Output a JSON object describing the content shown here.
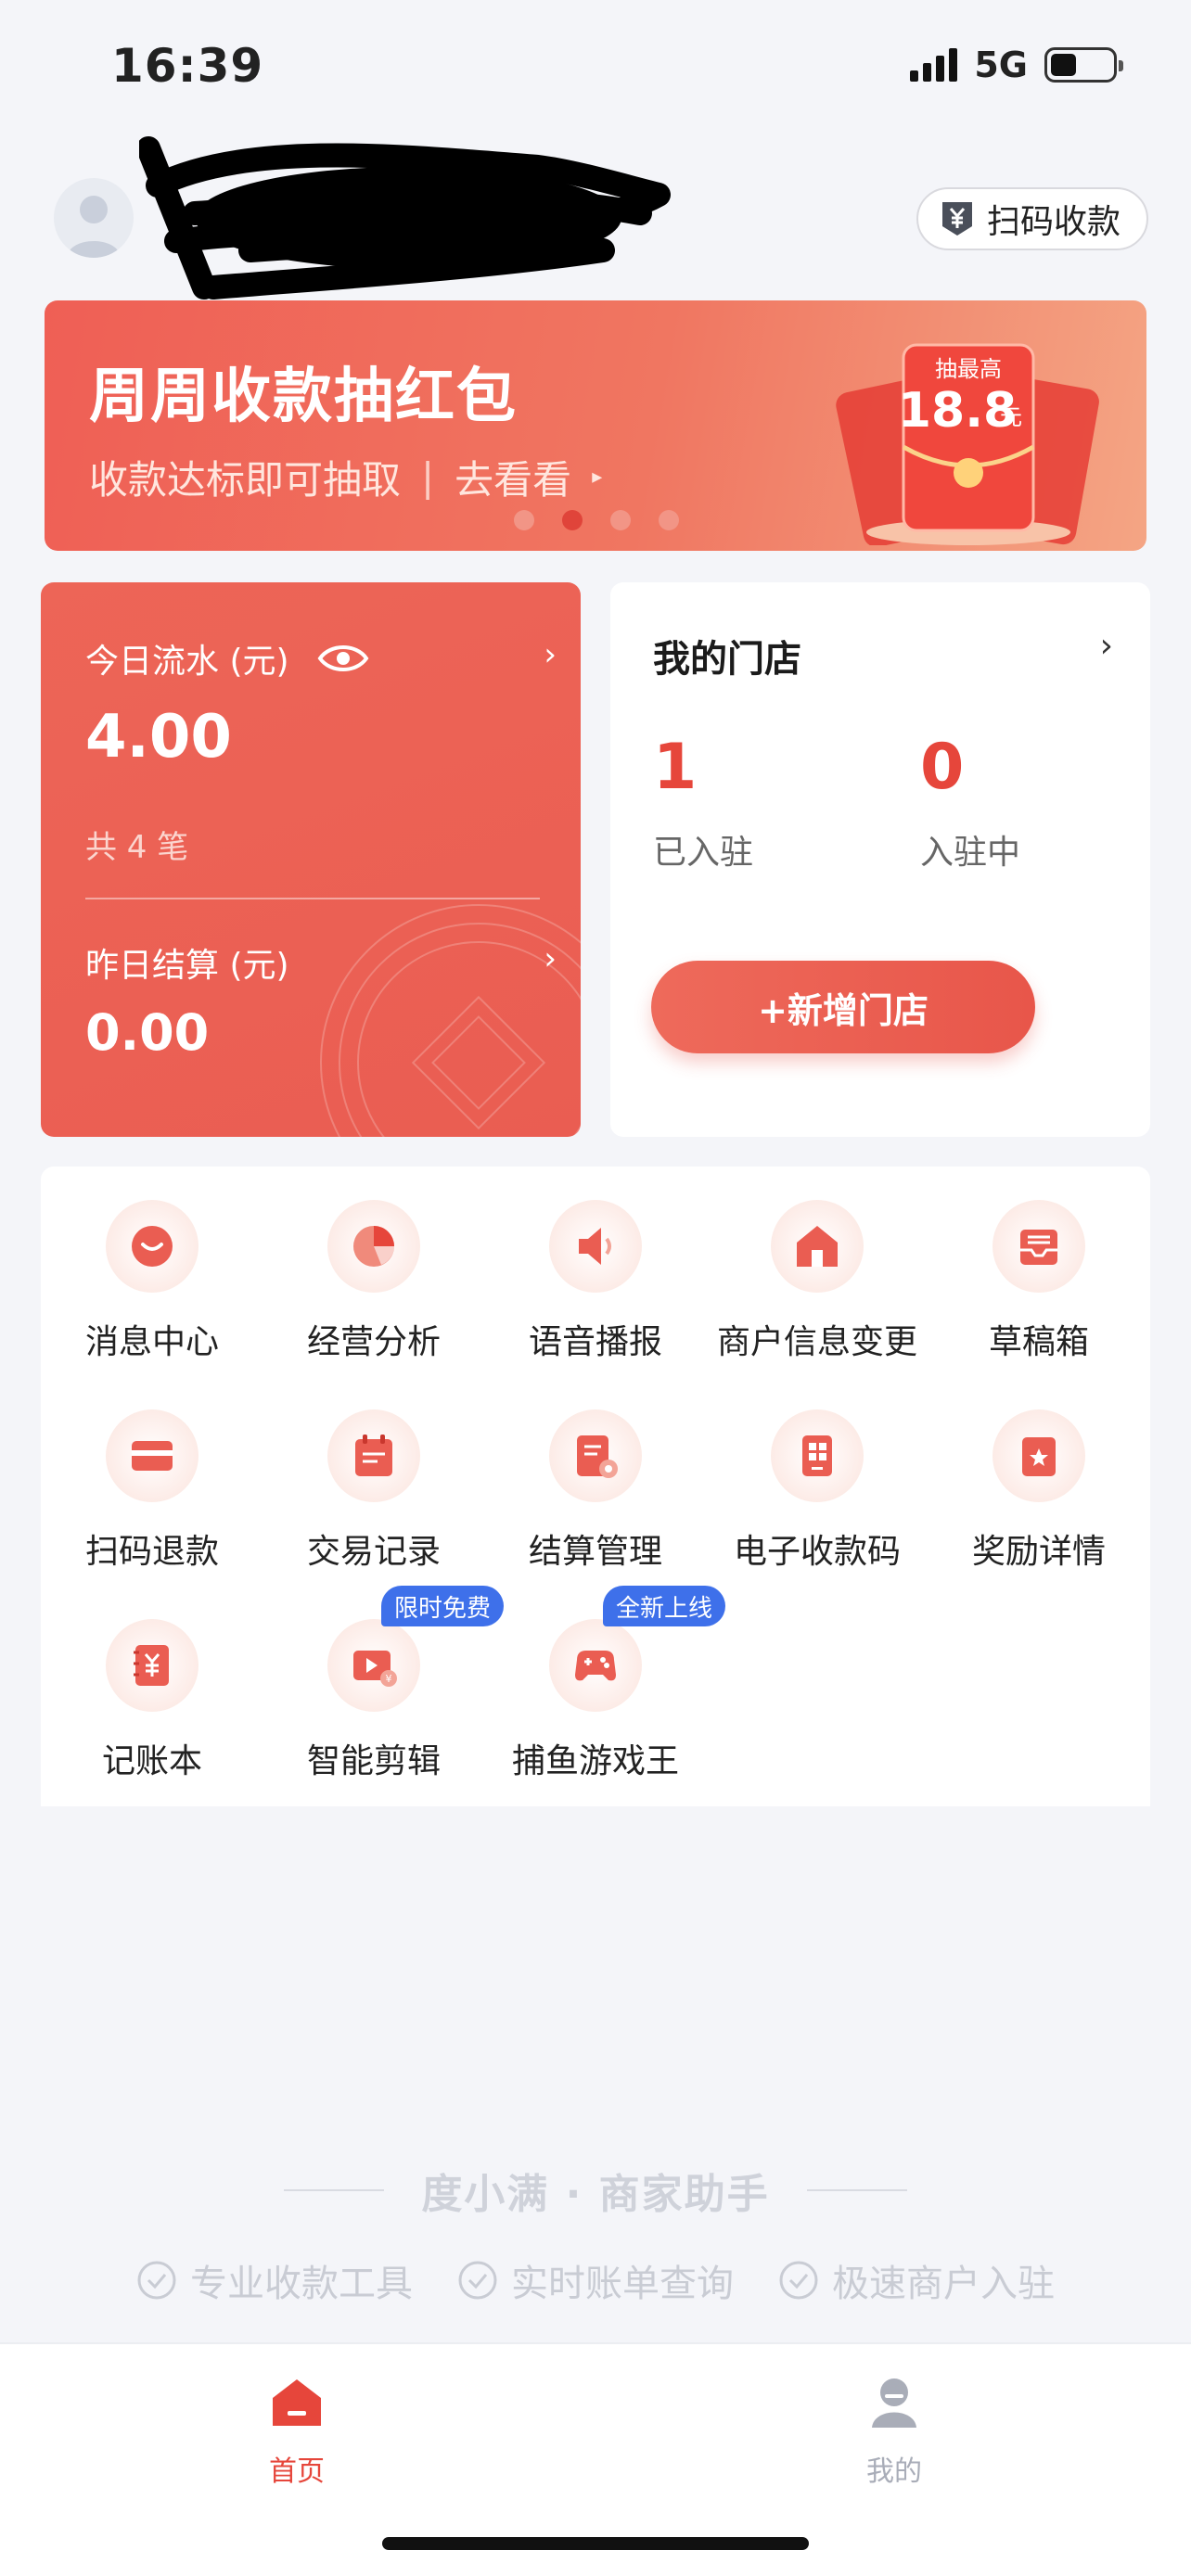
{
  "status_bar": {
    "time": "16:39",
    "network": "5G",
    "battery_level": 0.42
  },
  "header": {
    "scan_pay_label": "扫码收款"
  },
  "banner": {
    "title": "周周收款抽红包",
    "subtitle": "收款达标即可抽取",
    "separator": "|",
    "link_label": "去看看",
    "redpack_tag": "抽最高",
    "redpack_amount": "18.8",
    "redpack_unit": "元",
    "page_count": 4,
    "active_page": 1
  },
  "revenue": {
    "today_label": "今日流水 (元)",
    "today_amount": "4.00",
    "count_text": "共 4 笔",
    "yesterday_label": "昨日结算 (元)",
    "yesterday_amount": "0.00"
  },
  "store": {
    "title": "我的门店",
    "settled_count": "1",
    "settled_label": "已入驻",
    "pending_count": "0",
    "pending_label": "入驻中",
    "add_button": "+新增门店"
  },
  "features_grid": [
    {
      "label": "消息中心",
      "icon": "message-icon"
    },
    {
      "label": "经营分析",
      "icon": "pie-chart-icon"
    },
    {
      "label": "语音播报",
      "icon": "speaker-icon"
    },
    {
      "label": "商户信息变更",
      "icon": "shop-icon"
    },
    {
      "label": "草稿箱",
      "icon": "inbox-icon"
    },
    {
      "label": "扫码退款",
      "icon": "card-icon"
    },
    {
      "label": "交易记录",
      "icon": "calendar-icon"
    },
    {
      "label": "结算管理",
      "icon": "document-icon"
    },
    {
      "label": "电子收款码",
      "icon": "qrcode-icon"
    },
    {
      "label": "奖励详情",
      "icon": "reward-icon"
    },
    {
      "label": "记账本",
      "icon": "ledger-icon"
    },
    {
      "label": "智能剪辑",
      "icon": "video-edit-icon",
      "badge": "限时免费"
    },
    {
      "label": "捕鱼游戏王",
      "icon": "gamepad-icon",
      "badge": "全新上线"
    }
  ],
  "footer": {
    "brand": "度小满 · 商家助手",
    "features": [
      "专业收款工具",
      "实时账单查询",
      "极速商户入驻"
    ]
  },
  "tab_bar": {
    "home_label": "首页",
    "mine_label": "我的",
    "active_color": "#e6463b",
    "inactive_color": "#a9adb8"
  },
  "colors": {
    "accent": "#ea5d52",
    "badge_blue": "#3e70ea"
  }
}
